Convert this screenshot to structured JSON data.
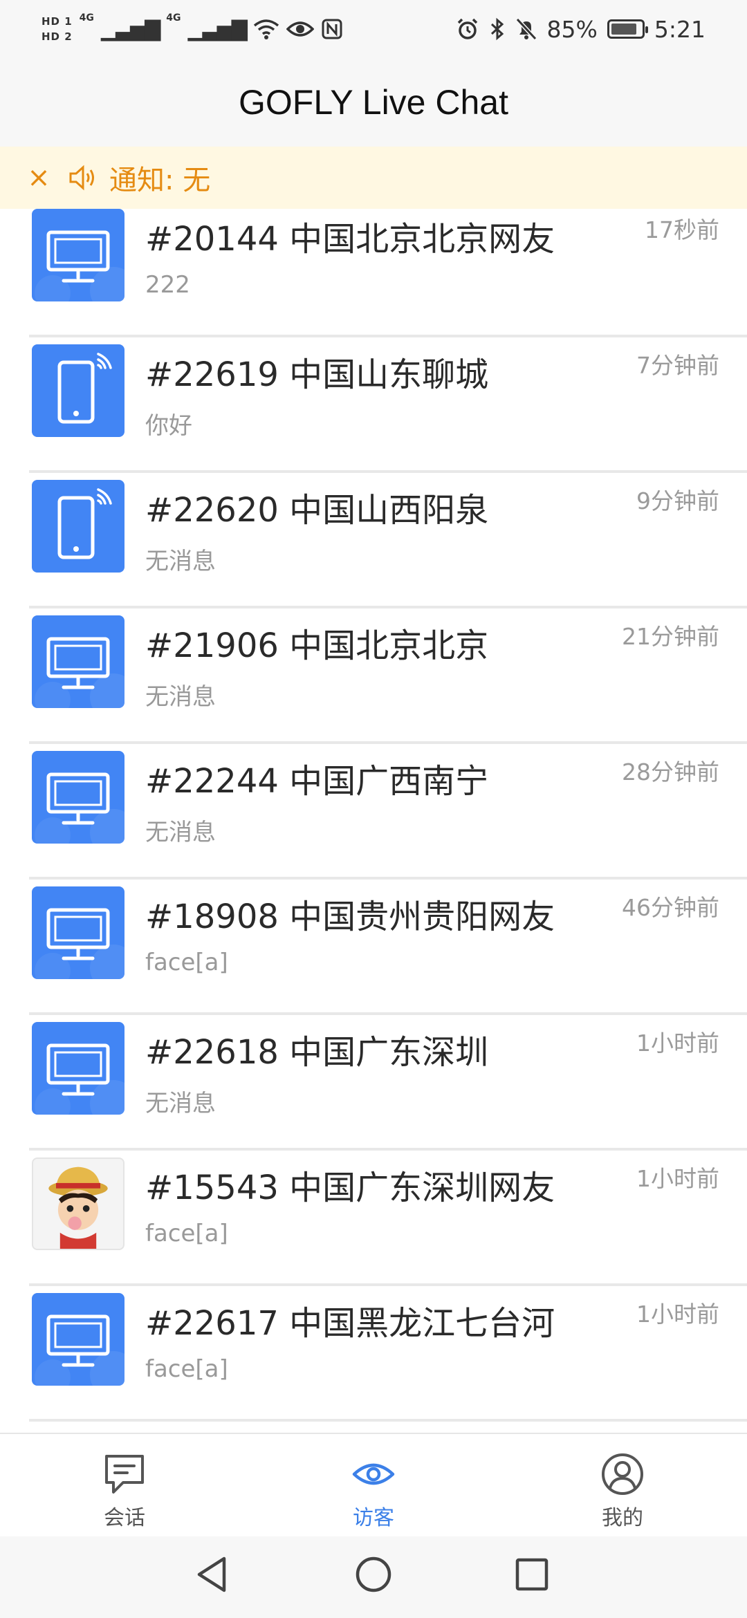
{
  "status_bar": {
    "hd1": "HD 1",
    "hd2": "HD 2",
    "net1": "4G",
    "net2": "4G",
    "battery_text": "85%",
    "battery_level": 0.85,
    "time": "5:21"
  },
  "header": {
    "title": "GOFLY Live Chat"
  },
  "notice": {
    "text": "通知: 无",
    "color": "#e58b12"
  },
  "visitors": [
    {
      "name": "#20144 中国北京北京网友",
      "message": "222",
      "time": "17秒前",
      "avatar": "pc-icon"
    },
    {
      "name": "#22619 中国山东聊城",
      "message": "你好",
      "time": "7分钟前",
      "avatar": "phone-icon"
    },
    {
      "name": "#22620 中国山西阳泉",
      "message": "无消息",
      "time": "9分钟前",
      "avatar": "phone-icon"
    },
    {
      "name": "#21906 中国北京北京",
      "message": "无消息",
      "time": "21分钟前",
      "avatar": "pc-icon"
    },
    {
      "name": "#22244 中国广西南宁",
      "message": "无消息",
      "time": "28分钟前",
      "avatar": "pc-icon"
    },
    {
      "name": "#18908 中国贵州贵阳网友",
      "message": "face[a]",
      "time": "46分钟前",
      "avatar": "pc-icon"
    },
    {
      "name": "#22618 中国广东深圳",
      "message": "无消息",
      "time": "1小时前",
      "avatar": "pc-icon"
    },
    {
      "name": "#15543 中国广东深圳网友",
      "message": "face[a]",
      "time": "1小时前",
      "avatar": "cartoon-avatar"
    },
    {
      "name": "#22617 中国黑龙江七台河",
      "message": "face[a]",
      "time": "1小时前",
      "avatar": "pc-icon"
    }
  ],
  "tabs": [
    {
      "label": "会话",
      "icon": "chat-icon",
      "active": false
    },
    {
      "label": "访客",
      "icon": "eye-icon",
      "active": true
    },
    {
      "label": "我的",
      "icon": "profile-icon",
      "active": false
    }
  ],
  "colors": {
    "accent": "#3c80e8",
    "avatar_bg": "#4285f4",
    "notice_bg": "#fff8e2"
  }
}
